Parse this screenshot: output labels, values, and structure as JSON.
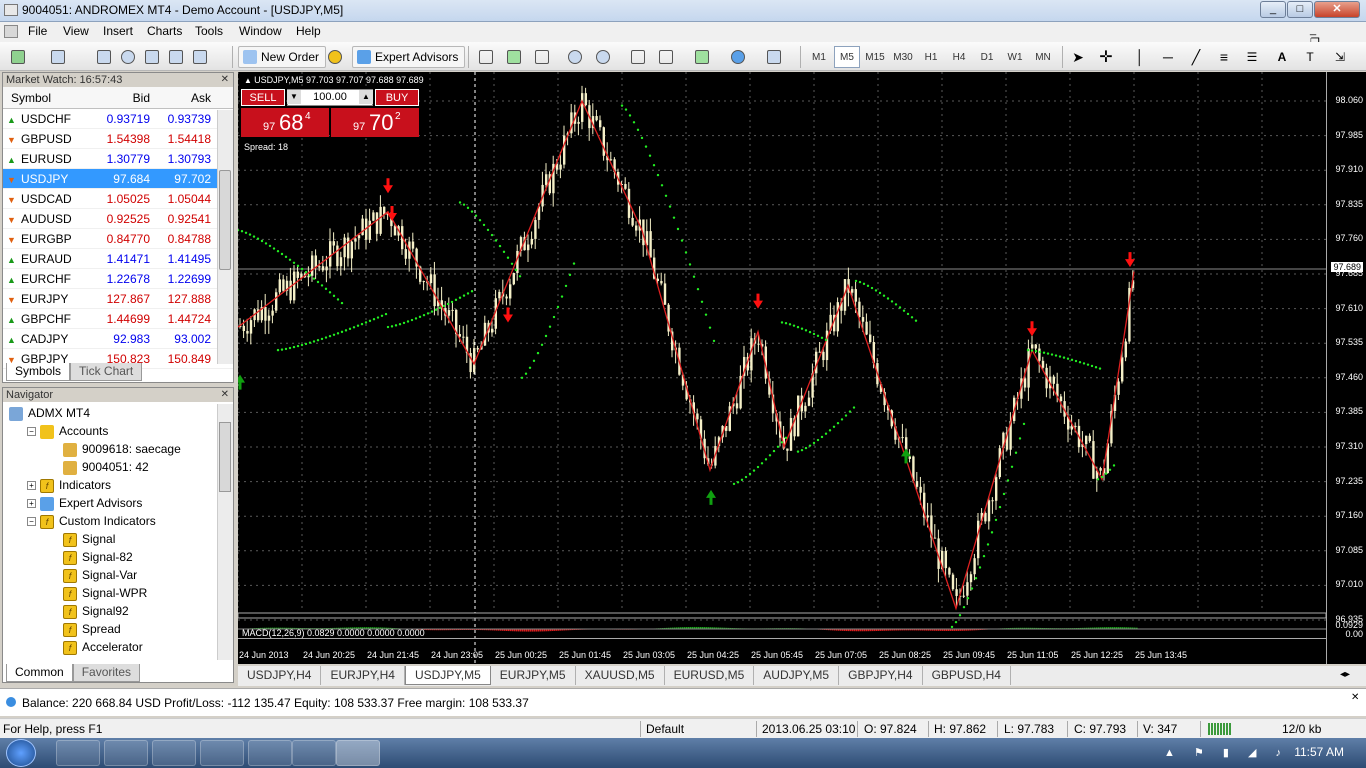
{
  "window": {
    "title": "9004051: ANDROMEX MT4 - Demo Account - [USDJPY,M5]",
    "min": "_",
    "max": "□",
    "close": "✕"
  },
  "menu": [
    "File",
    "View",
    "Insert",
    "Charts",
    "Tools",
    "Window",
    "Help"
  ],
  "toolbar": {
    "new_order": "New Order",
    "expert_advisors": "Expert Advisors",
    "timeframes": [
      "M1",
      "M5",
      "M15",
      "M30",
      "H1",
      "H4",
      "D1",
      "W1",
      "MN"
    ],
    "active_timeframe": "M5"
  },
  "market_watch": {
    "title": "Market Watch: 16:57:43",
    "columns": [
      "Symbol",
      "Bid",
      "Ask"
    ],
    "rows": [
      {
        "symbol": "USDCHF",
        "bid": "0.93719",
        "ask": "0.93739",
        "dir": "up",
        "color": "blue"
      },
      {
        "symbol": "GBPUSD",
        "bid": "1.54398",
        "ask": "1.54418",
        "dir": "down",
        "color": "red"
      },
      {
        "symbol": "EURUSD",
        "bid": "1.30779",
        "ask": "1.30793",
        "dir": "up",
        "color": "blue"
      },
      {
        "symbol": "USDJPY",
        "bid": "97.684",
        "ask": "97.702",
        "dir": "down",
        "color": "red",
        "selected": true
      },
      {
        "symbol": "USDCAD",
        "bid": "1.05025",
        "ask": "1.05044",
        "dir": "down",
        "color": "red"
      },
      {
        "symbol": "AUDUSD",
        "bid": "0.92525",
        "ask": "0.92541",
        "dir": "down",
        "color": "red"
      },
      {
        "symbol": "EURGBP",
        "bid": "0.84770",
        "ask": "0.84788",
        "dir": "down",
        "color": "red"
      },
      {
        "symbol": "EURAUD",
        "bid": "1.41471",
        "ask": "1.41495",
        "dir": "up",
        "color": "blue"
      },
      {
        "symbol": "EURCHF",
        "bid": "1.22678",
        "ask": "1.22699",
        "dir": "up",
        "color": "blue"
      },
      {
        "symbol": "EURJPY",
        "bid": "127.867",
        "ask": "127.888",
        "dir": "down",
        "color": "red"
      },
      {
        "symbol": "GBPCHF",
        "bid": "1.44699",
        "ask": "1.44724",
        "dir": "up",
        "color": "red"
      },
      {
        "symbol": "CADJPY",
        "bid": "92.983",
        "ask": "93.002",
        "dir": "up",
        "color": "blue"
      },
      {
        "symbol": "GBPJPY",
        "bid": "150.823",
        "ask": "150.849",
        "dir": "down",
        "color": "red"
      }
    ],
    "tabs": [
      "Symbols",
      "Tick Chart"
    ]
  },
  "navigator": {
    "title": "Navigator",
    "items": [
      {
        "label": "ADMX MT4",
        "level": 0,
        "icon": "computer-icon"
      },
      {
        "label": "Accounts",
        "level": 1,
        "icon": "accounts-icon",
        "exp": "−"
      },
      {
        "label": "9009618: saecage",
        "level": 2,
        "icon": "user-icon"
      },
      {
        "label": "9004051: 42",
        "level": 2,
        "icon": "user-icon"
      },
      {
        "label": "Indicators",
        "level": 1,
        "icon": "fx-icon",
        "exp": "+"
      },
      {
        "label": "Expert Advisors",
        "level": 1,
        "icon": "expert-icon",
        "exp": "+"
      },
      {
        "label": "Custom Indicators",
        "level": 1,
        "icon": "fx-icon",
        "exp": "−"
      },
      {
        "label": "Signal",
        "level": 2,
        "icon": "fx-icon"
      },
      {
        "label": "Signal-82",
        "level": 2,
        "icon": "fx-icon"
      },
      {
        "label": "Signal-Var",
        "level": 2,
        "icon": "fx-icon"
      },
      {
        "label": "Signal-WPR",
        "level": 2,
        "icon": "fx-icon"
      },
      {
        "label": "Signal92",
        "level": 2,
        "icon": "fx-icon"
      },
      {
        "label": "Spread",
        "level": 2,
        "icon": "fx-icon"
      },
      {
        "label": "Accelerator",
        "level": 2,
        "icon": "fx-icon"
      }
    ],
    "tabs": [
      "Common",
      "Favorites"
    ]
  },
  "chart": {
    "header": "USDJPY,M5  97.703 97.707 97.688 97.689",
    "sell": "SELL",
    "buy": "BUY",
    "lot": "100.00",
    "sell_price": {
      "small": "97",
      "big": "68",
      "sup": "4"
    },
    "buy_price": {
      "small": "97",
      "big": "70",
      "sup": "2"
    },
    "spread": "Spread: 18",
    "macd": "MACD(12,26,9) 0.0829 0.0000 0.0000 0.0000",
    "price_labels": [
      "98.060",
      "97.985",
      "97.910",
      "97.835",
      "97.760",
      "97.685",
      "97.610",
      "97.535",
      "97.460",
      "97.385",
      "97.310",
      "97.235",
      "97.160",
      "97.085",
      "97.010",
      "96.935"
    ],
    "current_price": "97.689",
    "macd_labels": [
      "0.0929",
      "0.00"
    ],
    "time_labels": [
      "24 Jun 2013",
      "24 Jun 20:25",
      "24 Jun 21:45",
      "24 Jun 23:05",
      "25 Jun 00:25",
      "25 Jun 01:45",
      "25 Jun 03:05",
      "25 Jun 04:25",
      "25 Jun 05:45",
      "25 Jun 07:05",
      "25 Jun 08:25",
      "25 Jun 09:45",
      "25 Jun 11:05",
      "25 Jun 12:25",
      "25 Jun 13:45"
    ],
    "colors": {
      "bg": "#000000",
      "candle": "#f5f0c8",
      "zigzag": "#e02020",
      "sar": "#22ee22",
      "arrow_down": "#ff1010",
      "arrow_up": "#10a010"
    }
  },
  "chart_tabs": [
    "USDJPY,H4",
    "EURJPY,H4",
    "USDJPY,M5",
    "EURJPY,M5",
    "XAUUSD,M5",
    "EURUSD,M5",
    "AUDJPY,M5",
    "GBPJPY,H4",
    "GBPUSD,H4"
  ],
  "active_chart_tab": "USDJPY,M5",
  "balance": "Balance: 220 668.84 USD  Profit/Loss: -112 135.47  Equity: 108 533.37  Free margin: 108 533.37",
  "status": {
    "help": "For Help, press F1",
    "profile": "Default",
    "datetime": "2013.06.25 03:10",
    "open": "O: 97.824",
    "high": "H: 97.862",
    "low": "L: 97.783",
    "close": "C: 97.793",
    "volume": "V: 347",
    "traffic": "12/0 kb"
  },
  "clock": "11:57 AM"
}
